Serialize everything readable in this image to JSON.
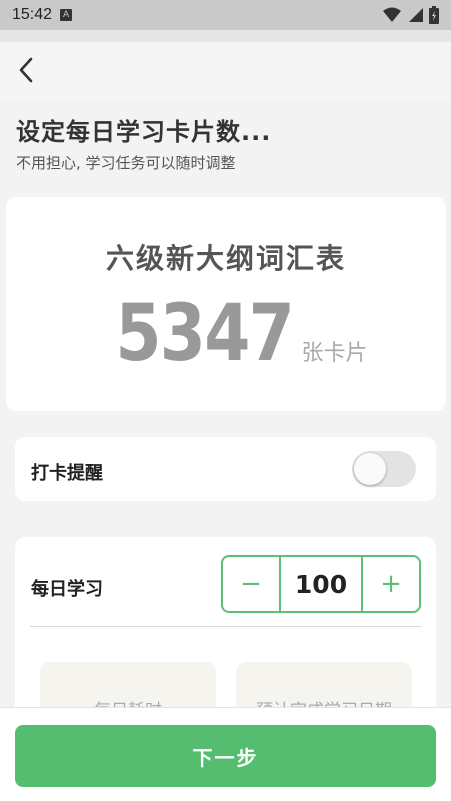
{
  "status_bar": {
    "time": "15:42",
    "notification_icon": "a-icon",
    "icons": [
      "wifi-icon",
      "signal-icon",
      "battery-icon"
    ]
  },
  "header": {
    "back_icon": "chevron-left-icon",
    "title": "设定每日学习卡片数...",
    "subtitle": "不用担心, 学习任务可以随时调整"
  },
  "wordlist": {
    "name": "六级新大纲词汇表",
    "count": "5347",
    "unit": "张卡片"
  },
  "reminder": {
    "label": "打卡提醒",
    "enabled": false
  },
  "daily": {
    "label": "每日学习",
    "minus": "−",
    "plus": "+",
    "value": "100",
    "info_left": "每日耗时",
    "info_right": "预计完成学习日期"
  },
  "footer": {
    "next_label": "下一步"
  },
  "colors": {
    "accent": "#55bd70",
    "stepper_border": "#5cbf74"
  }
}
